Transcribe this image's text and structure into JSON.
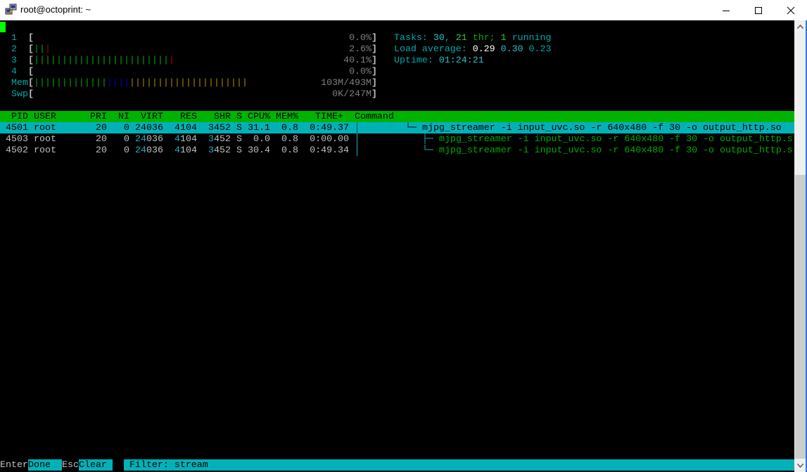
{
  "window": {
    "title": "root@octoprint: ~",
    "controls": {
      "minimize": "minimize",
      "maximize": "maximize",
      "close": "close"
    }
  },
  "meters": {
    "cpus": [
      {
        "label": "1",
        "percent": 0.0,
        "value_text": "0.0%",
        "bars": []
      },
      {
        "label": "2",
        "percent": 2.6,
        "value_text": "2.6%",
        "bars": [
          "green",
          "green",
          "red"
        ]
      },
      {
        "label": "3",
        "percent": 40.1,
        "value_text": "40.1%",
        "bars": [
          "green",
          "green",
          "green",
          "green",
          "green",
          "green",
          "green",
          "green",
          "green",
          "green",
          "green",
          "green",
          "green",
          "green",
          "green",
          "green",
          "green",
          "green",
          "green",
          "green",
          "green",
          "green",
          "green",
          "green",
          "red"
        ]
      },
      {
        "label": "4",
        "percent": 0.0,
        "value_text": "0.0%",
        "bars": []
      }
    ],
    "mem": {
      "label": "Mem",
      "value_text": "103M/493M",
      "used_mb": 103,
      "total_mb": 493,
      "segments": {
        "green": 13,
        "blue": 4,
        "yellow": 21
      }
    },
    "swap": {
      "label": "Swp",
      "value_text": "0K/247M",
      "used_kb": 0,
      "total_mb": 247
    }
  },
  "summary": {
    "tasks_label": "Tasks: ",
    "tasks": "30",
    "threads": "21",
    "thr_label": " thr; ",
    "running": "1",
    "running_label": " running",
    "load_label": "Load average: ",
    "load_1": "0.29",
    "load_5": "0.30",
    "load_15": "0.23",
    "uptime_label": "Uptime: ",
    "uptime": "01:24:21"
  },
  "table": {
    "headers": {
      "pid": "PID",
      "user": "USER",
      "pri": "PRI",
      "ni": "NI",
      "virt": "VIRT",
      "res": "RES",
      "shr": "SHR",
      "s": "S",
      "cpu": "CPU%",
      "mem": "MEM%",
      "time": "TIME+",
      "command": "Command"
    },
    "rows": [
      {
        "pid": "4501",
        "user": "root",
        "pri": "20",
        "ni": "0",
        "virt_hi": "24",
        "virt_lo": "036",
        "res_hi": "4",
        "res_lo": "104",
        "shr_hi": "3",
        "shr_lo": "452",
        "s": "S",
        "cpu": "31.1",
        "mem": "0.8",
        "time": "0:49.37",
        "tree": "└─",
        "command": "mjpg_streamer -i input_uvc.so -r 640x480 -f 30 -o output_http.so",
        "selected": true
      },
      {
        "pid": "4503",
        "user": "root",
        "pri": "20",
        "ni": "0",
        "virt_hi": "24",
        "virt_lo": "036",
        "res_hi": "4",
        "res_lo": "104",
        "shr_hi": "3",
        "shr_lo": "452",
        "s": "S",
        "cpu": "0.0",
        "mem": "0.8",
        "time": "0:00.00",
        "tree": "├─",
        "command": "mjpg_streamer -i input_uvc.so -r 640x480 -f 30 -o output_http.s",
        "selected": false
      },
      {
        "pid": "4502",
        "user": "root",
        "pri": "20",
        "ni": "0",
        "virt_hi": "24",
        "virt_lo": "036",
        "res_hi": "4",
        "res_lo": "104",
        "shr_hi": "3",
        "shr_lo": "452",
        "s": "S",
        "cpu": "30.4",
        "mem": "0.8",
        "time": "0:49.34",
        "tree": "└─",
        "command": "mjpg_streamer -i input_uvc.so -r 640x480 -f 30 -o output_http.s",
        "selected": false
      }
    ]
  },
  "footer": {
    "enter_key": "Enter",
    "enter_label": "Done  ",
    "esc_key": "Esc",
    "esc_label": "Clear ",
    "filter_text": "Filter: stream"
  },
  "colors": {
    "header_bg": "#00b300",
    "selected_bg": "#00b2b8",
    "cursor": "#00ff00"
  }
}
